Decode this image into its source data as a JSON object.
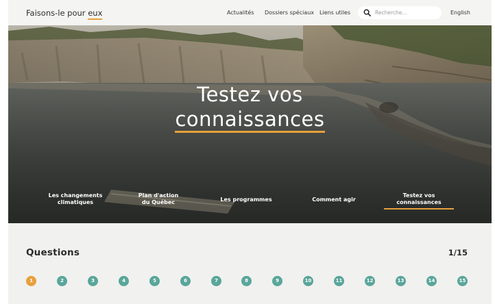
{
  "header": {
    "logo_text": "Faisons-le pour",
    "logo_emph": "eux",
    "nav": [
      "Actualités",
      "Dossiers spéciaux",
      "Liens utiles"
    ],
    "search_placeholder": "Recherche...",
    "language": "English"
  },
  "hero": {
    "title_line1": "Testez vos",
    "title_line2": "connaissances",
    "subnav": [
      {
        "line1": "Les changements",
        "line2": "climatiques"
      },
      {
        "line1": "Plan d'action",
        "line2": "du Québec"
      },
      {
        "line1": "Les programmes",
        "line2": ""
      },
      {
        "line1": "Comment agir",
        "line2": ""
      },
      {
        "line1": "Testez vos",
        "line2": "connaissances"
      }
    ]
  },
  "questions": {
    "title": "Questions",
    "counter": "1/15",
    "numbers": [
      "1",
      "2",
      "3",
      "4",
      "5",
      "6",
      "7",
      "8",
      "9",
      "10",
      "11",
      "12",
      "13",
      "14",
      "15"
    ]
  },
  "colors": {
    "accent": "#e8a03d",
    "dot": "#5aa69a",
    "background": "#f1f1ef"
  }
}
